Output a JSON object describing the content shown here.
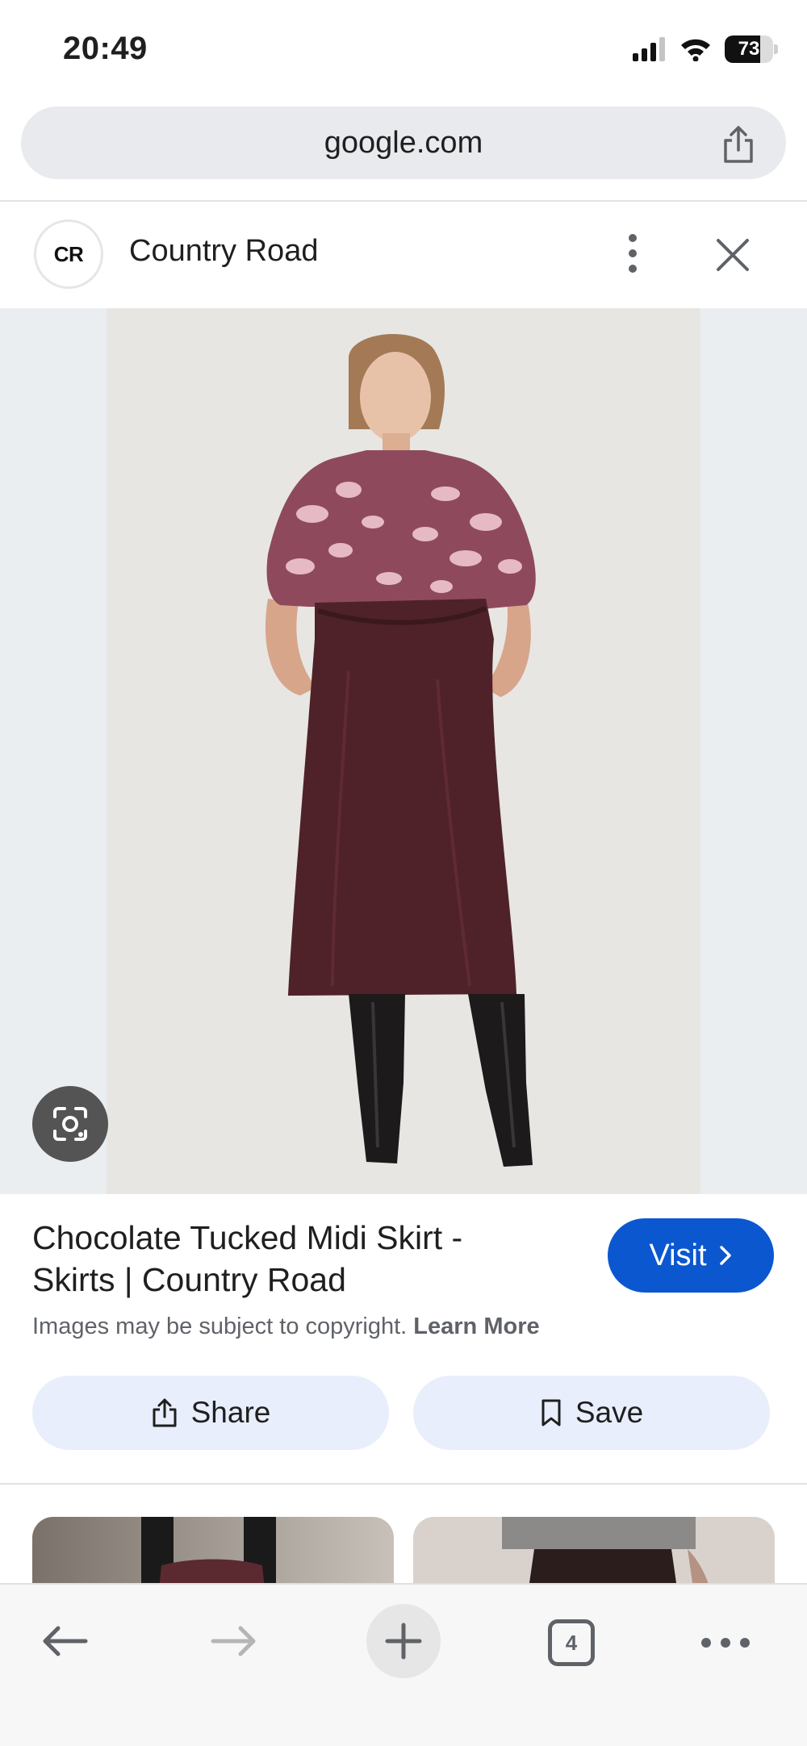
{
  "status_bar": {
    "time": "20:49",
    "battery_level": "73",
    "battery_fraction": 0.73,
    "icons": [
      "signal-icon",
      "wifi-icon",
      "battery-icon"
    ]
  },
  "browser": {
    "url": "google.com",
    "icons": [
      "share-icon"
    ]
  },
  "source": {
    "logo_text": "CR",
    "name": "Country Road",
    "icons": [
      "more-vert-icon",
      "close-icon"
    ]
  },
  "image": {
    "icons": [
      "lens-icon"
    ]
  },
  "result": {
    "title": "Chocolate Tucked Midi Skirt - Skirts | Country Road",
    "visit_label": "Visit",
    "copyright_text": "Images may be subject to copyright.",
    "learn_more_label": "Learn More",
    "share_label": "Share",
    "save_label": "Save"
  },
  "toolbar": {
    "tab_count": "4",
    "icons": [
      "back-icon",
      "forward-icon",
      "new-tab-icon",
      "tabs-icon",
      "more-icon"
    ]
  },
  "colors": {
    "accent": "#0b57d0",
    "chip_bg": "#e8eefb",
    "url_bar_bg": "#e8eaed"
  }
}
